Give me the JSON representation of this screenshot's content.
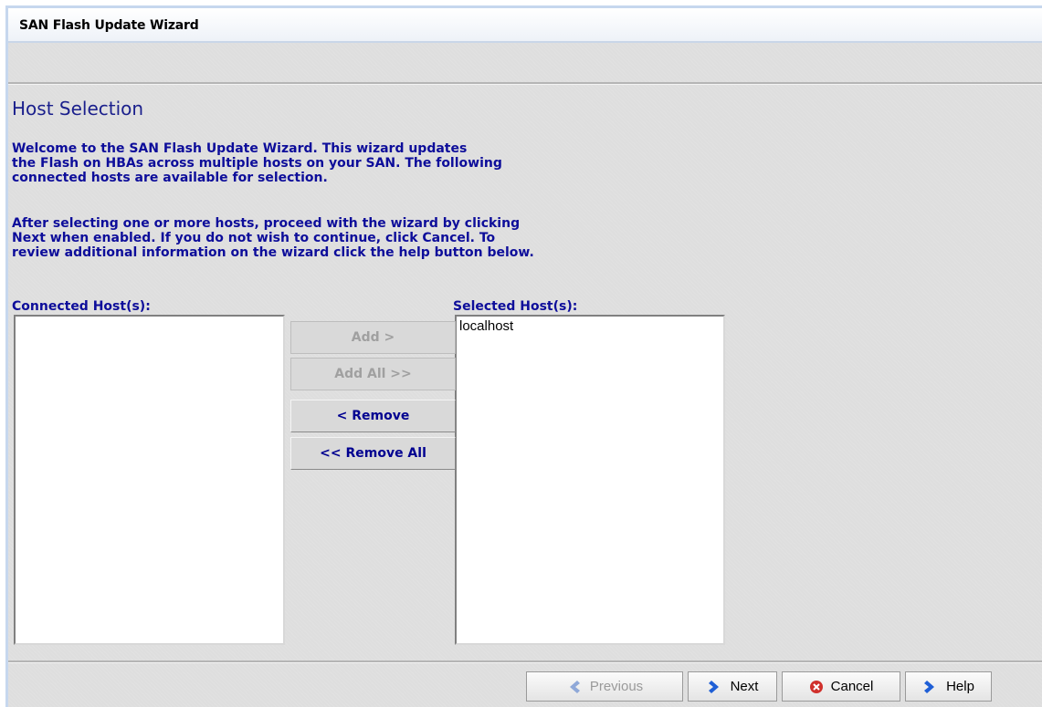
{
  "window": {
    "title": "SAN Flash Update Wizard"
  },
  "page": {
    "heading": "Host Selection",
    "description_1": "Welcome to the SAN Flash Update Wizard. This wizard updates\nthe Flash on HBAs across multiple hosts on your SAN. The following\nconnected hosts are available for selection.",
    "description_2": "After selecting one or more hosts, proceed with the wizard by clicking\nNext when enabled. If you do not wish to continue, click Cancel.  To\nreview additional information on the wizard click the help button below."
  },
  "connected": {
    "label": "Connected Host(s):",
    "items": []
  },
  "selected": {
    "label": "Selected Host(s):",
    "items": [
      "localhost"
    ]
  },
  "transfer_buttons": {
    "add": "Add >",
    "add_all": "Add All >>",
    "remove": "< Remove",
    "remove_all": "<< Remove All"
  },
  "nav_buttons": {
    "previous": "Previous",
    "next": "Next",
    "cancel": "Cancel",
    "help": "Help"
  },
  "icons": {
    "previous": "chevron-left-icon",
    "next": "chevron-right-icon",
    "cancel": "cancel-icon",
    "help": "chevron-right-icon"
  },
  "colors": {
    "heading": "#1a1f8c",
    "text": "#0d0d9a",
    "arrow": "#1f5fd6",
    "cancel": "#d0302c"
  }
}
